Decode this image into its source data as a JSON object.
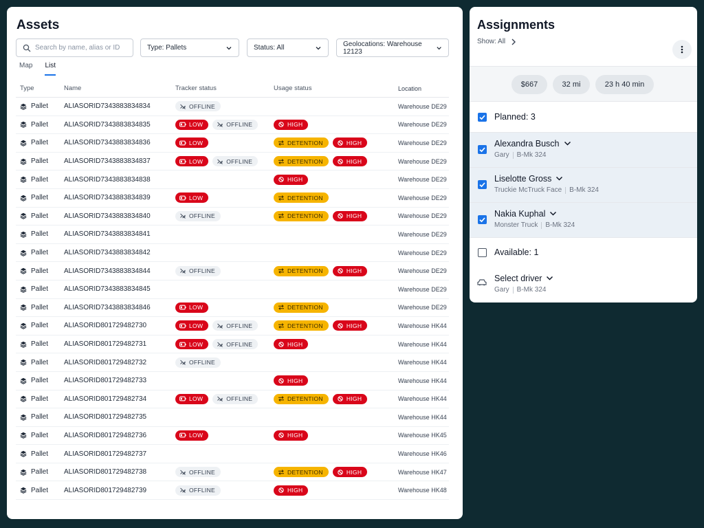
{
  "assets": {
    "title": "Assets",
    "search_placeholder": "Search by name, alias or ID",
    "filters": {
      "type": "Type: Pallets",
      "status": "Status: All",
      "geo": "Geolocations: Warehouse 12123"
    },
    "tabs": [
      "Map",
      "List"
    ],
    "active_tab": "List",
    "columns": [
      "Type",
      "Name",
      "Tracker status",
      "Usage status",
      "Location"
    ],
    "rows": [
      {
        "type": "Pallet",
        "name": "ALIASORID7343883834834",
        "tracker": [
          "OFFLINE"
        ],
        "usage": [],
        "location": "Warehouse DE29"
      },
      {
        "type": "Pallet",
        "name": "ALIASORID7343883834835",
        "tracker": [
          "LOW",
          "OFFLINE"
        ],
        "usage": [
          "HIGH"
        ],
        "location": "Warehouse DE29"
      },
      {
        "type": "Pallet",
        "name": "ALIASORID7343883834836",
        "tracker": [
          "LOW"
        ],
        "usage": [
          "DETENTION",
          "HIGH"
        ],
        "location": "Warehouse DE29"
      },
      {
        "type": "Pallet",
        "name": "ALIASORID7343883834837",
        "tracker": [
          "LOW",
          "OFFLINE"
        ],
        "usage": [
          "DETENTION",
          "HIGH"
        ],
        "location": "Warehouse DE29"
      },
      {
        "type": "Pallet",
        "name": "ALIASORID7343883834838",
        "tracker": [],
        "usage": [
          "HIGH"
        ],
        "location": "Warehouse DE29"
      },
      {
        "type": "Pallet",
        "name": "ALIASORID7343883834839",
        "tracker": [
          "LOW"
        ],
        "usage": [
          "DETENTION"
        ],
        "location": "Warehouse DE29"
      },
      {
        "type": "Pallet",
        "name": "ALIASORID7343883834840",
        "tracker": [
          "OFFLINE"
        ],
        "usage": [
          "DETENTION",
          "HIGH"
        ],
        "location": "Warehouse DE29"
      },
      {
        "type": "Pallet",
        "name": "ALIASORID7343883834841",
        "tracker": [],
        "usage": [],
        "location": "Warehouse DE29"
      },
      {
        "type": "Pallet",
        "name": "ALIASORID7343883834842",
        "tracker": [],
        "usage": [],
        "location": "Warehouse DE29"
      },
      {
        "type": "Pallet",
        "name": "ALIASORID7343883834844",
        "tracker": [
          "OFFLINE"
        ],
        "usage": [
          "DETENTION",
          "HIGH"
        ],
        "location": "Warehouse DE29"
      },
      {
        "type": "Pallet",
        "name": "ALIASORID7343883834845",
        "tracker": [],
        "usage": [],
        "location": "Warehouse DE29"
      },
      {
        "type": "Pallet",
        "name": "ALIASORID7343883834846",
        "tracker": [
          "LOW"
        ],
        "usage": [
          "DETENTION"
        ],
        "location": "Warehouse DE29"
      },
      {
        "type": "Pallet",
        "name": "ALIASORID801729482730",
        "tracker": [
          "LOW",
          "OFFLINE"
        ],
        "usage": [
          "DETENTION",
          "HIGH"
        ],
        "location": "Warehouse HK44"
      },
      {
        "type": "Pallet",
        "name": "ALIASORID801729482731",
        "tracker": [
          "LOW",
          "OFFLINE"
        ],
        "usage": [
          "HIGH"
        ],
        "location": "Warehouse HK44"
      },
      {
        "type": "Pallet",
        "name": "ALIASORID801729482732",
        "tracker": [
          "OFFLINE"
        ],
        "usage": [],
        "location": "Warehouse HK44"
      },
      {
        "type": "Pallet",
        "name": "ALIASORID801729482733",
        "tracker": [],
        "usage": [
          "HIGH"
        ],
        "location": "Warehouse HK44"
      },
      {
        "type": "Pallet",
        "name": "ALIASORID801729482734",
        "tracker": [
          "LOW",
          "OFFLINE"
        ],
        "usage": [
          "DETENTION",
          "HIGH"
        ],
        "location": "Warehouse HK44"
      },
      {
        "type": "Pallet",
        "name": "ALIASORID801729482735",
        "tracker": [],
        "usage": [],
        "location": "Warehouse HK44"
      },
      {
        "type": "Pallet",
        "name": "ALIASORID801729482736",
        "tracker": [
          "LOW"
        ],
        "usage": [
          "HIGH"
        ],
        "location": "Warehouse HK45"
      },
      {
        "type": "Pallet",
        "name": "ALIASORID801729482737",
        "tracker": [],
        "usage": [],
        "location": "Warehouse HK46"
      },
      {
        "type": "Pallet",
        "name": "ALIASORID801729482738",
        "tracker": [
          "OFFLINE"
        ],
        "usage": [
          "DETENTION",
          "HIGH"
        ],
        "location": "Warehouse HK47"
      },
      {
        "type": "Pallet",
        "name": "ALIASORID801729482739",
        "tracker": [
          "OFFLINE"
        ],
        "usage": [
          "HIGH"
        ],
        "location": "Warehouse HK48"
      }
    ]
  },
  "assignments": {
    "title": "Assignments",
    "show_all": "Show: All",
    "stats": {
      "cost": "$667",
      "distance": "32 mi",
      "duration": "23 h 40 min"
    },
    "planned_label": "Planned: 3",
    "drivers": [
      {
        "name": "Alexandra Busch",
        "vehicle": "Gary",
        "plate": "B-Mk 324"
      },
      {
        "name": "Liselotte Gross",
        "vehicle": "Truckie McTruck Face",
        "plate": "B-Mk 324"
      },
      {
        "name": "Nakia Kuphal",
        "vehicle": "Monster Truck",
        "plate": "B-Mk 324"
      }
    ],
    "available_label": "Available: 1",
    "select_driver": {
      "label": "Select driver",
      "vehicle": "Gary",
      "plate": "B-Mk 324"
    }
  },
  "colors": {
    "accent": "#1a73e8",
    "alert": "#d9061a",
    "warning": "#f6b400",
    "background": "#0f2a31"
  }
}
